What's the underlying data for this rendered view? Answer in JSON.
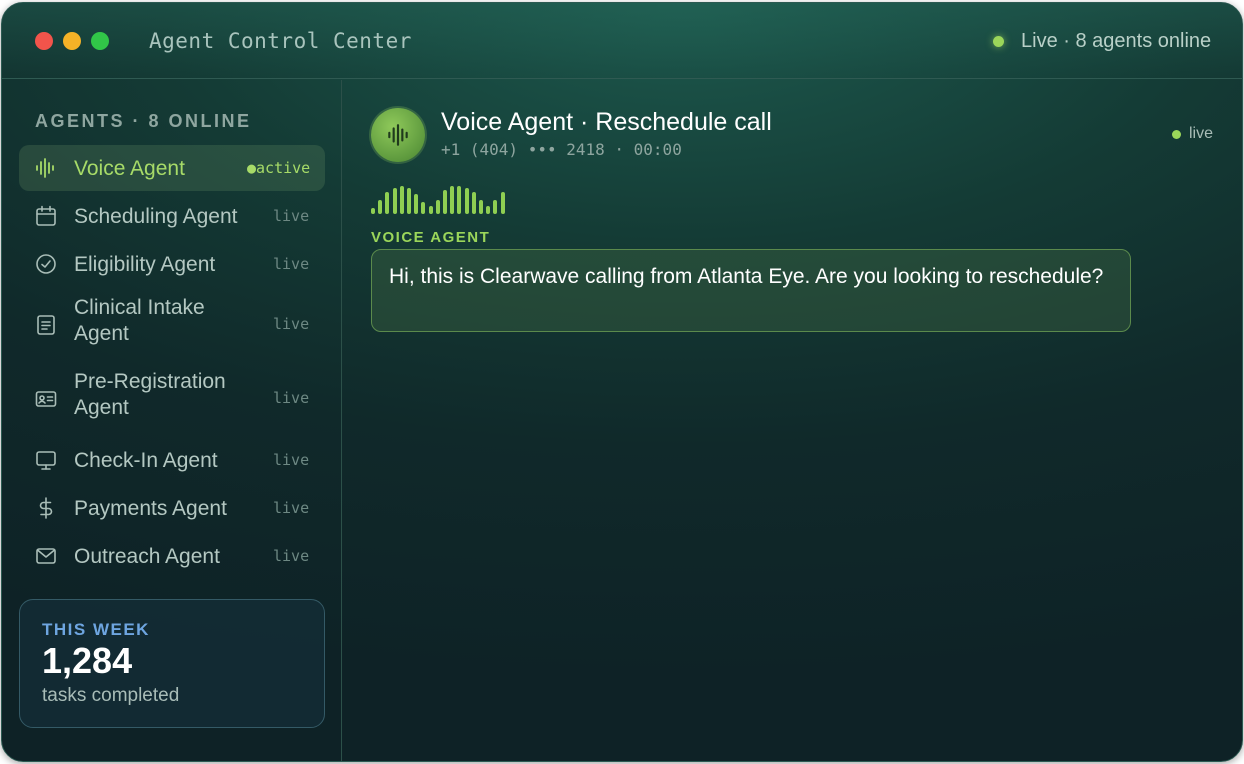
{
  "window": {
    "title": "Agent Control Center",
    "status": "Live · 8 agents online",
    "colors": {
      "accent": "#9bd65a",
      "background": "#143b35",
      "card_border": "#345a66",
      "week_label": "#6ea5e0"
    }
  },
  "sidebar": {
    "heading": "AGENTS · 8 ONLINE",
    "items": [
      {
        "label": "Voice Agent",
        "state": "●active",
        "icon": "waveform-icon",
        "active": true
      },
      {
        "label": "Scheduling Agent",
        "state": "live",
        "icon": "calendar-icon"
      },
      {
        "label": "Eligibility Agent",
        "state": "live",
        "icon": "check-circle-icon"
      },
      {
        "label": "Clinical Intake Agent",
        "state": "live",
        "icon": "document-icon"
      },
      {
        "label": "Pre-Registration Agent",
        "state": "live",
        "icon": "id-card-icon"
      },
      {
        "label": "Check-In Agent",
        "state": "live",
        "icon": "monitor-icon"
      },
      {
        "label": "Payments Agent",
        "state": "live",
        "icon": "dollar-icon"
      },
      {
        "label": "Outreach Agent",
        "state": "live",
        "icon": "mail-icon"
      }
    ],
    "week_card": {
      "label": "THIS WEEK",
      "value": "1,284",
      "subtitle": "tasks completed"
    }
  },
  "call": {
    "title": "Voice Agent · Reschedule call",
    "subtitle": "+1 (404) ••• 2418 · 00:00",
    "status": "live",
    "speaker": "VOICE AGENT",
    "message": "Hi, this is Clearwave calling from Atlanta Eye. Are you looking to reschedule?"
  }
}
